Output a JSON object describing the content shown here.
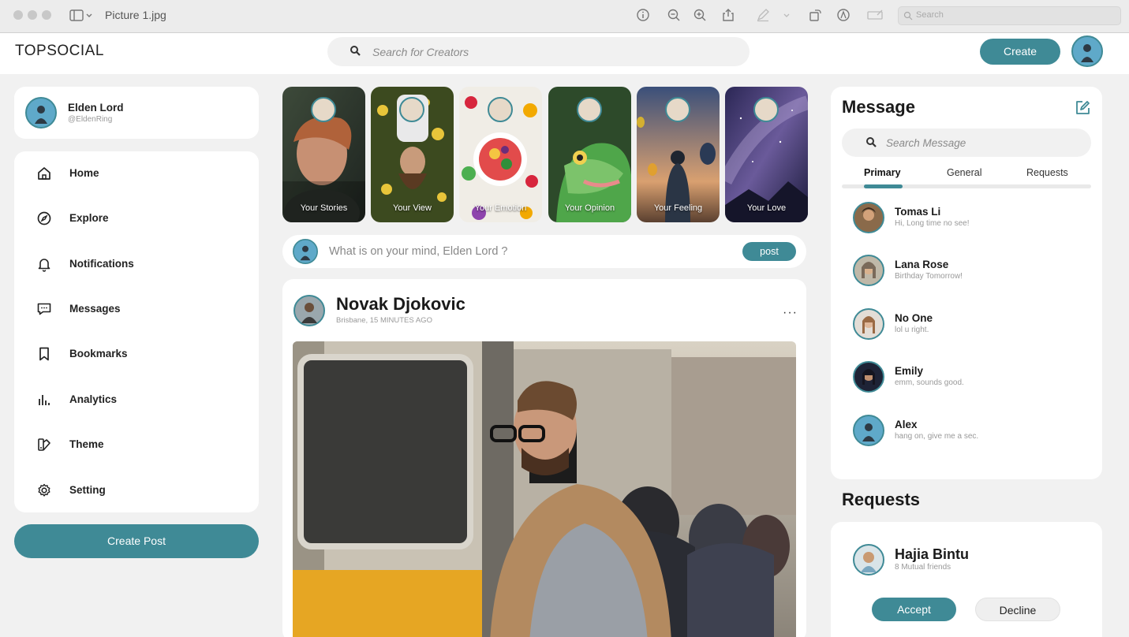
{
  "window": {
    "title": "Picture 1.jpg",
    "search_placeholder": "Search"
  },
  "header": {
    "logo": "TOPSOCIAL",
    "search_placeholder": "Search for Creators",
    "create_label": "Create"
  },
  "profile": {
    "name": "Elden Lord",
    "handle": "@EldenRing"
  },
  "sidebar": {
    "items": [
      {
        "label": "Home",
        "icon": "home-icon"
      },
      {
        "label": "Explore",
        "icon": "compass-icon"
      },
      {
        "label": "Notifications",
        "icon": "bell-icon"
      },
      {
        "label": "Messages",
        "icon": "chat-icon"
      },
      {
        "label": "Bookmarks",
        "icon": "bookmark-icon"
      },
      {
        "label": "Analytics",
        "icon": "chart-icon"
      },
      {
        "label": "Theme",
        "icon": "palette-icon"
      },
      {
        "label": "Setting",
        "icon": "gear-icon"
      }
    ],
    "create_post_label": "Create Post"
  },
  "stories": [
    {
      "label": "Your Stories"
    },
    {
      "label": "Your View"
    },
    {
      "label": "Your Emotion"
    },
    {
      "label": "Your Opinion"
    },
    {
      "label": "Your Feeling"
    },
    {
      "label": "Your Love"
    }
  ],
  "compose": {
    "placeholder": "What is on your mind, Elden Lord ?",
    "post_label": "post"
  },
  "post": {
    "author": "Novak Djokovic",
    "meta": "Brisbane, 15 MINUTES AGO",
    "more": "···"
  },
  "messages": {
    "title": "Message",
    "search_placeholder": "Search Message",
    "tabs": [
      "Primary",
      "General",
      "Requests"
    ],
    "active_tab": "Primary",
    "items": [
      {
        "name": "Tomas Li",
        "text": "Hi, Long time no see!"
      },
      {
        "name": "Lana Rose",
        "text": "Birthday Tomorrow!"
      },
      {
        "name": "No One",
        "text": "lol u right."
      },
      {
        "name": "Emily",
        "text": "emm, sounds good."
      },
      {
        "name": "Alex",
        "text": "hang on, give me a sec."
      }
    ]
  },
  "requests": {
    "title": "Requests",
    "name": "Hajia Bintu",
    "mutual": "8 Mutual friends",
    "accept_label": "Accept",
    "decline_label": "Decline"
  },
  "colors": {
    "accent": "#3f8a96",
    "background": "#f1f1f1"
  }
}
